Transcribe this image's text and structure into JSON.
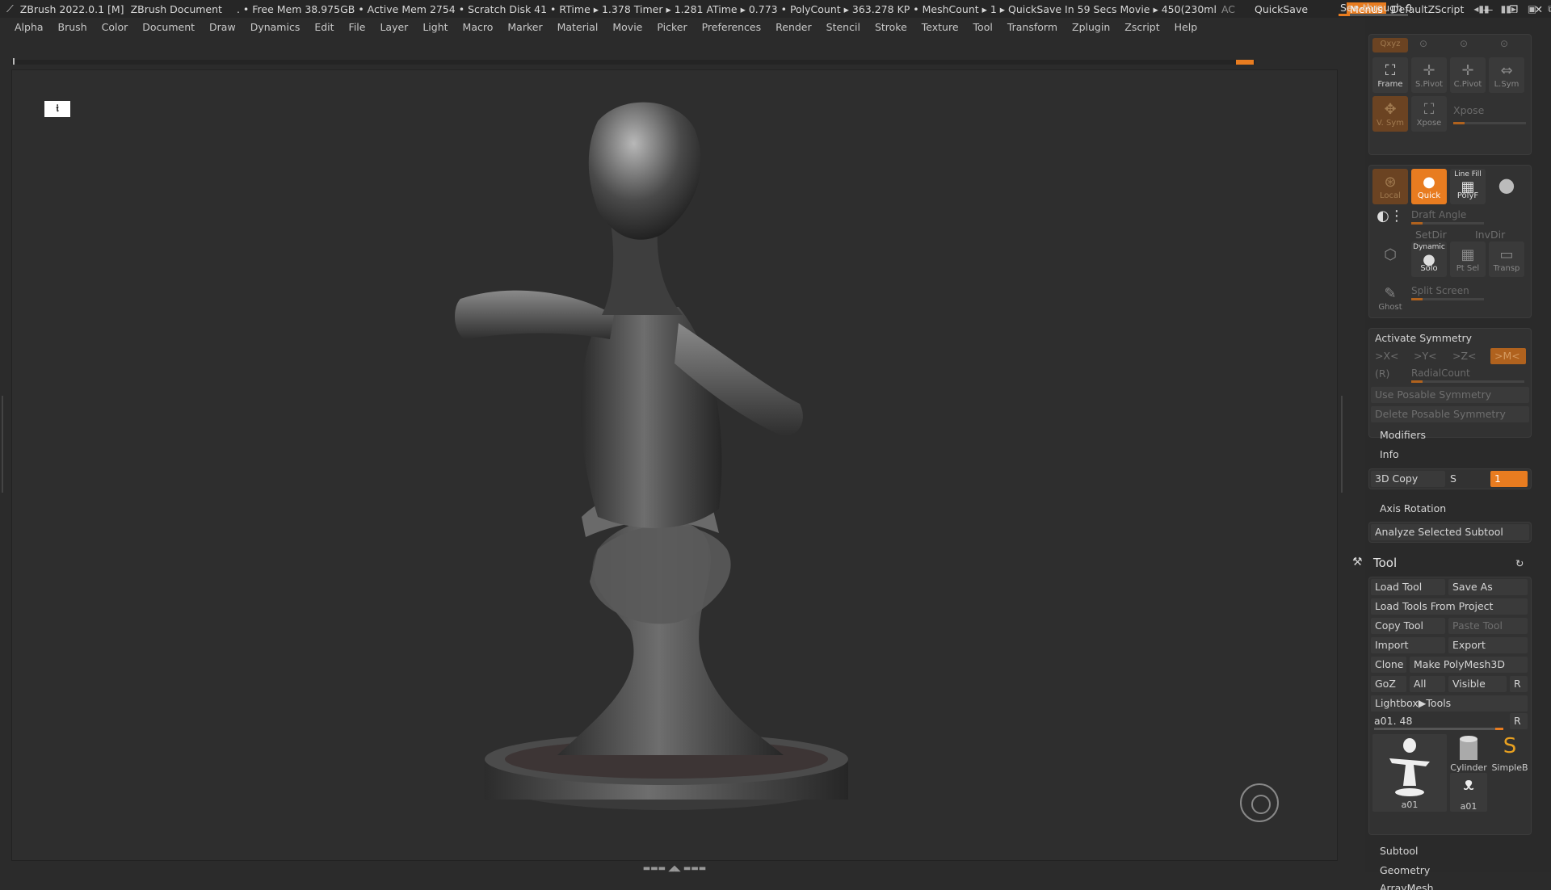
{
  "titlebar": {
    "app": "ZBrush 2022.0.1 [M]",
    "doc": "ZBrush Document",
    "stats": ". • Free Mem 38.975GB • Active Mem 2754 • Scratch Disk 41 • RTime ▸ 1.378 Timer ▸ 1.281 ATime ▸ 0.773 • PolyCount ▸ 363.278 KP • MeshCount ▸ 1 ▸ QuickSave In 59 Secs Movie ▸ 450(230ml",
    "ac": "AC",
    "quicksave": "QuickSave",
    "seethrough": "See-through 0",
    "seethrough_value": 0,
    "menus": "Menus",
    "script": "DefaultZScript"
  },
  "menubar": [
    "Alpha",
    "Brush",
    "Color",
    "Document",
    "Draw",
    "Dynamics",
    "Edit",
    "File",
    "Layer",
    "Light",
    "Macro",
    "Marker",
    "Material",
    "Movie",
    "Picker",
    "Preferences",
    "Render",
    "Stencil",
    "Stroke",
    "Texture",
    "Tool",
    "Transform",
    "Zplugin",
    "Zscript",
    "Help"
  ],
  "shelf": {
    "xyz": "Qxyz",
    "frame": "Frame",
    "spivot": "S.Pivot",
    "cpivot": "C.Pivot",
    "lsym": "L.Sym",
    "vsym": "V. Sym",
    "xpose_btn": "Xpose",
    "xpose": "Xpose",
    "local": "Local",
    "quick": "Quick",
    "linefill": "Line Fill",
    "polyf": "PolyF",
    "draft_angle": "Draft Angle",
    "setdir": "SetDir",
    "invdir": "InvDir",
    "dynamic": "Dynamic",
    "solo": "Solo",
    "ptsel": "Pt Sel",
    "transp": "Transp",
    "ghost": "Ghost",
    "split_screen": "Split Screen"
  },
  "symmetry": {
    "title": "Activate Symmetry",
    "x": ">X<",
    "y": ">Y<",
    "z": ">Z<",
    "m": ">M<",
    "r": "(R)",
    "radial": "RadialCount",
    "use_posable": "Use Posable Symmetry",
    "delete_posable": "Delete Posable Symmetry"
  },
  "sections": {
    "modifiers": "Modifiers",
    "info": "Info",
    "copy3d": "3D Copy",
    "s": "S",
    "s_value": "1",
    "axis_rotation": "Axis Rotation",
    "analyze": "Analyze Selected Subtool"
  },
  "tool": {
    "title": "Tool",
    "load": "Load Tool",
    "save_as": "Save As",
    "load_project": "Load Tools From Project",
    "copy": "Copy Tool",
    "paste": "Paste Tool",
    "import": "Import",
    "export": "Export",
    "clone": "Clone",
    "make_polymesh": "Make PolyMesh3D",
    "goz": "GoZ",
    "all": "All",
    "visible": "Visible",
    "r": "R",
    "lightbox": "Lightbox▶Tools",
    "current": "a01. 48",
    "r2": "R",
    "thumb_main": "a01",
    "thumb_cyl": "Cylinder",
    "thumb_simple": "SimpleB",
    "thumb_small": "a01",
    "subtool": "Subtool",
    "geometry": "Geometry",
    "arraymesh": "ArrayMesh"
  }
}
